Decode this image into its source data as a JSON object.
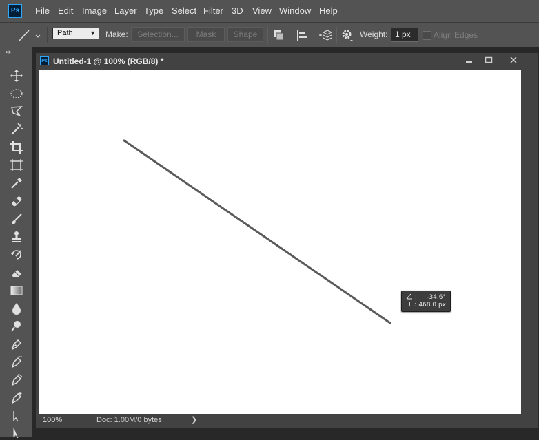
{
  "app": {
    "logo_text": "Ps"
  },
  "menu": [
    "File",
    "Edit",
    "Image",
    "Layer",
    "Type",
    "Select",
    "Filter",
    "3D",
    "View",
    "Window",
    "Help"
  ],
  "options_bar": {
    "tool_mode": "Path",
    "make_label": "Make:",
    "selection_button": "Selection...",
    "mask_button": "Mask",
    "shape_button": "Shape",
    "weight_label": "Weight:",
    "weight_value": "1 px",
    "align_edges_label": "Align Edges",
    "align_edges_checked": false
  },
  "tools": [
    "move-tool",
    "elliptical-marquee-tool",
    "polygonal-lasso-tool",
    "magic-wand-tool",
    "crop-tool",
    "frame-tool",
    "eyedropper-tool",
    "spot-healing-brush-tool",
    "brush-tool",
    "clone-stamp-tool",
    "history-brush-tool",
    "eraser-tool",
    "gradient-tool",
    "blur-tool",
    "dodge-tool",
    "pen-tool",
    "freeform-pen-tool",
    "curvature-pen-tool",
    "add-anchor-point-tool",
    "path-selection-tool",
    "direct-selection-tool"
  ],
  "document": {
    "tab_icon_text": "Ps",
    "title": "Untitled-1 @ 100% (RGB/8) *",
    "zoom": "100%",
    "doc_info": "Doc: 1.00M/0 bytes"
  },
  "hud": {
    "angle_label": ":",
    "angle_value": "-34.6°",
    "length_label": "L :",
    "length_value": "468.0 px"
  },
  "colors": {
    "chrome": "#535353",
    "panel_dark": "#424242",
    "canvas": "#ffffff",
    "line": "#555555",
    "ps_blue": "#31a8ff"
  }
}
